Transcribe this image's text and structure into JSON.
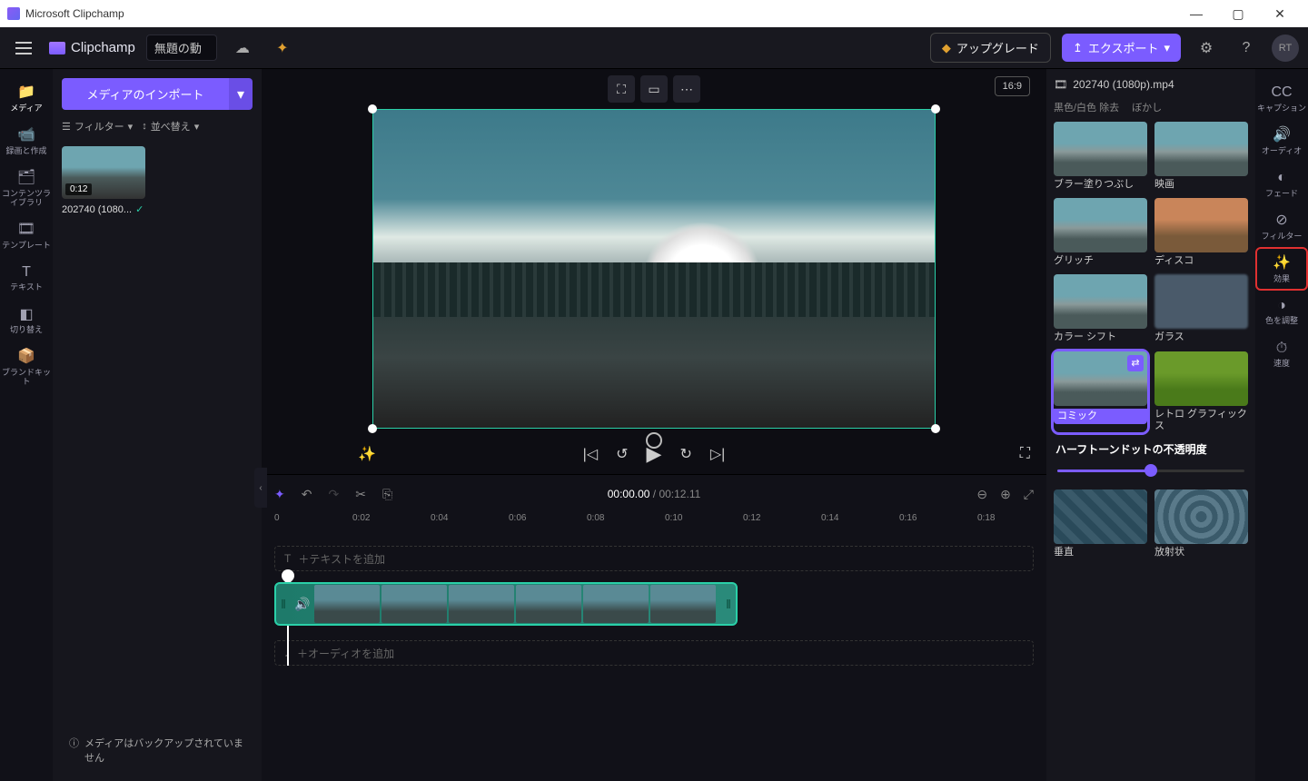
{
  "window": {
    "title": "Microsoft Clipchamp"
  },
  "appbar": {
    "brand": "Clipchamp",
    "project": "無題の動",
    "upgrade": "アップグレード",
    "export": "エクスポート",
    "avatar": "RT"
  },
  "leftrail": [
    {
      "icon": "📁",
      "label": "メディア",
      "active": true,
      "name": "media"
    },
    {
      "icon": "📹",
      "label": "録画と作成",
      "name": "record"
    },
    {
      "icon": "🗂",
      "label": "コンテンツライブラリ",
      "name": "content-library"
    },
    {
      "icon": "🎞",
      "label": "テンプレート",
      "name": "templates"
    },
    {
      "icon": "T",
      "label": "テキスト",
      "name": "text"
    },
    {
      "icon": "◧",
      "label": "切り替え",
      "name": "transitions"
    },
    {
      "icon": "📦",
      "label": "ブランドキット",
      "name": "brand-kit"
    }
  ],
  "mediapanel": {
    "import": "メディアのインポート",
    "filter": "フィルター",
    "sort": "並べ替え",
    "clip": {
      "duration": "0:12",
      "name": "202740 (1080..."
    },
    "backup": "メディアはバックアップされていません"
  },
  "preview": {
    "ratio": "16:9"
  },
  "timeline": {
    "current": "00:00.00",
    "total": "00:12.11",
    "ticks": [
      "0",
      "0:02",
      "0:04",
      "0:06",
      "0:08",
      "0:10",
      "0:12",
      "0:14",
      "0:16",
      "0:18"
    ],
    "text_track": "＋テキストを追加",
    "audio_track": "＋オーディオを追加"
  },
  "effects": {
    "header": "202740 (1080p).mp4",
    "tab1": "黒色/白色 除去",
    "tab2": "ぼかし",
    "items": [
      {
        "label": "ブラー塗りつぶし",
        "cls": ""
      },
      {
        "label": "映画",
        "cls": ""
      },
      {
        "label": "グリッチ",
        "cls": ""
      },
      {
        "label": "ディスコ",
        "cls": "disco"
      },
      {
        "label": "カラー シフト",
        "cls": ""
      },
      {
        "label": "ガラス",
        "cls": "glass"
      },
      {
        "label": "コミック",
        "cls": "",
        "selected": true
      },
      {
        "label": "レトロ グラフィックス",
        "cls": "retro"
      }
    ],
    "slider_label": "ハーフトーンドットの不透明度",
    "items2": [
      {
        "label": "垂直",
        "cls": "pattern"
      },
      {
        "label": "放射状",
        "cls": "radial"
      }
    ]
  },
  "rightrail": [
    {
      "icon": "CC",
      "label": "キャプション",
      "name": "captions"
    },
    {
      "icon": "🔊",
      "label": "オーディオ",
      "name": "audio"
    },
    {
      "icon": "◐",
      "label": "フェード",
      "name": "fade"
    },
    {
      "icon": "⊘",
      "label": "フィルター",
      "name": "filters"
    },
    {
      "icon": "✨",
      "label": "効果",
      "name": "effects",
      "boxed": true
    },
    {
      "icon": "◑",
      "label": "色を調整",
      "name": "adjust-color"
    },
    {
      "icon": "⏱",
      "label": "速度",
      "name": "speed"
    }
  ]
}
